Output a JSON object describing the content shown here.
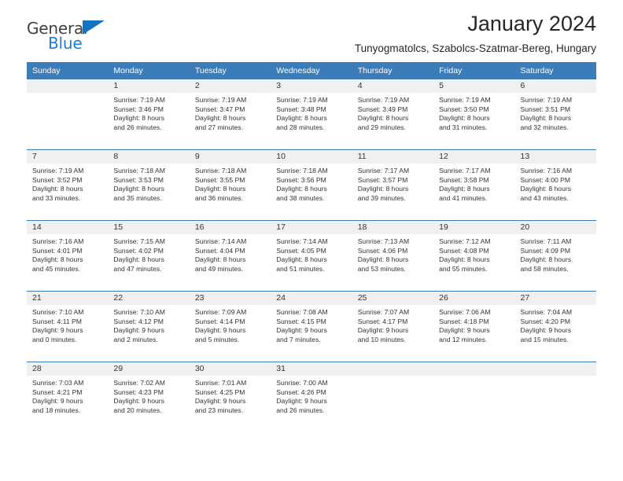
{
  "brand": {
    "name_part1": "General",
    "name_part2": "Blue",
    "accent_color": "#1e7fd0",
    "triangle_color": "#1274bf",
    "triangle_icon": "triangle-icon"
  },
  "header": {
    "title": "January 2024",
    "subtitle": "Tunyogmatolcs, Szabolcs-Szatmar-Bereg, Hungary"
  },
  "calendar": {
    "header_bg": "#3b7cb9",
    "daynum_bg": "#f0f0f0",
    "weekday_headers": [
      "Sunday",
      "Monday",
      "Tuesday",
      "Wednesday",
      "Thursday",
      "Friday",
      "Saturday"
    ],
    "weeks": [
      [
        {
          "day": "",
          "empty": true,
          "sunrise": "",
          "sunset": "",
          "daylight_line1": "",
          "daylight_line2": ""
        },
        {
          "day": "1",
          "sunrise": "Sunrise: 7:19 AM",
          "sunset": "Sunset: 3:46 PM",
          "daylight_line1": "Daylight: 8 hours",
          "daylight_line2": "and 26 minutes."
        },
        {
          "day": "2",
          "sunrise": "Sunrise: 7:19 AM",
          "sunset": "Sunset: 3:47 PM",
          "daylight_line1": "Daylight: 8 hours",
          "daylight_line2": "and 27 minutes."
        },
        {
          "day": "3",
          "sunrise": "Sunrise: 7:19 AM",
          "sunset": "Sunset: 3:48 PM",
          "daylight_line1": "Daylight: 8 hours",
          "daylight_line2": "and 28 minutes."
        },
        {
          "day": "4",
          "sunrise": "Sunrise: 7:19 AM",
          "sunset": "Sunset: 3:49 PM",
          "daylight_line1": "Daylight: 8 hours",
          "daylight_line2": "and 29 minutes."
        },
        {
          "day": "5",
          "sunrise": "Sunrise: 7:19 AM",
          "sunset": "Sunset: 3:50 PM",
          "daylight_line1": "Daylight: 8 hours",
          "daylight_line2": "and 31 minutes."
        },
        {
          "day": "6",
          "sunrise": "Sunrise: 7:19 AM",
          "sunset": "Sunset: 3:51 PM",
          "daylight_line1": "Daylight: 8 hours",
          "daylight_line2": "and 32 minutes."
        }
      ],
      [
        {
          "day": "7",
          "sunrise": "Sunrise: 7:19 AM",
          "sunset": "Sunset: 3:52 PM",
          "daylight_line1": "Daylight: 8 hours",
          "daylight_line2": "and 33 minutes."
        },
        {
          "day": "8",
          "sunrise": "Sunrise: 7:18 AM",
          "sunset": "Sunset: 3:53 PM",
          "daylight_line1": "Daylight: 8 hours",
          "daylight_line2": "and 35 minutes."
        },
        {
          "day": "9",
          "sunrise": "Sunrise: 7:18 AM",
          "sunset": "Sunset: 3:55 PM",
          "daylight_line1": "Daylight: 8 hours",
          "daylight_line2": "and 36 minutes."
        },
        {
          "day": "10",
          "sunrise": "Sunrise: 7:18 AM",
          "sunset": "Sunset: 3:56 PM",
          "daylight_line1": "Daylight: 8 hours",
          "daylight_line2": "and 38 minutes."
        },
        {
          "day": "11",
          "sunrise": "Sunrise: 7:17 AM",
          "sunset": "Sunset: 3:57 PM",
          "daylight_line1": "Daylight: 8 hours",
          "daylight_line2": "and 39 minutes."
        },
        {
          "day": "12",
          "sunrise": "Sunrise: 7:17 AM",
          "sunset": "Sunset: 3:58 PM",
          "daylight_line1": "Daylight: 8 hours",
          "daylight_line2": "and 41 minutes."
        },
        {
          "day": "13",
          "sunrise": "Sunrise: 7:16 AM",
          "sunset": "Sunset: 4:00 PM",
          "daylight_line1": "Daylight: 8 hours",
          "daylight_line2": "and 43 minutes."
        }
      ],
      [
        {
          "day": "14",
          "sunrise": "Sunrise: 7:16 AM",
          "sunset": "Sunset: 4:01 PM",
          "daylight_line1": "Daylight: 8 hours",
          "daylight_line2": "and 45 minutes."
        },
        {
          "day": "15",
          "sunrise": "Sunrise: 7:15 AM",
          "sunset": "Sunset: 4:02 PM",
          "daylight_line1": "Daylight: 8 hours",
          "daylight_line2": "and 47 minutes."
        },
        {
          "day": "16",
          "sunrise": "Sunrise: 7:14 AM",
          "sunset": "Sunset: 4:04 PM",
          "daylight_line1": "Daylight: 8 hours",
          "daylight_line2": "and 49 minutes."
        },
        {
          "day": "17",
          "sunrise": "Sunrise: 7:14 AM",
          "sunset": "Sunset: 4:05 PM",
          "daylight_line1": "Daylight: 8 hours",
          "daylight_line2": "and 51 minutes."
        },
        {
          "day": "18",
          "sunrise": "Sunrise: 7:13 AM",
          "sunset": "Sunset: 4:06 PM",
          "daylight_line1": "Daylight: 8 hours",
          "daylight_line2": "and 53 minutes."
        },
        {
          "day": "19",
          "sunrise": "Sunrise: 7:12 AM",
          "sunset": "Sunset: 4:08 PM",
          "daylight_line1": "Daylight: 8 hours",
          "daylight_line2": "and 55 minutes."
        },
        {
          "day": "20",
          "sunrise": "Sunrise: 7:11 AM",
          "sunset": "Sunset: 4:09 PM",
          "daylight_line1": "Daylight: 8 hours",
          "daylight_line2": "and 58 minutes."
        }
      ],
      [
        {
          "day": "21",
          "sunrise": "Sunrise: 7:10 AM",
          "sunset": "Sunset: 4:11 PM",
          "daylight_line1": "Daylight: 9 hours",
          "daylight_line2": "and 0 minutes."
        },
        {
          "day": "22",
          "sunrise": "Sunrise: 7:10 AM",
          "sunset": "Sunset: 4:12 PM",
          "daylight_line1": "Daylight: 9 hours",
          "daylight_line2": "and 2 minutes."
        },
        {
          "day": "23",
          "sunrise": "Sunrise: 7:09 AM",
          "sunset": "Sunset: 4:14 PM",
          "daylight_line1": "Daylight: 9 hours",
          "daylight_line2": "and 5 minutes."
        },
        {
          "day": "24",
          "sunrise": "Sunrise: 7:08 AM",
          "sunset": "Sunset: 4:15 PM",
          "daylight_line1": "Daylight: 9 hours",
          "daylight_line2": "and 7 minutes."
        },
        {
          "day": "25",
          "sunrise": "Sunrise: 7:07 AM",
          "sunset": "Sunset: 4:17 PM",
          "daylight_line1": "Daylight: 9 hours",
          "daylight_line2": "and 10 minutes."
        },
        {
          "day": "26",
          "sunrise": "Sunrise: 7:06 AM",
          "sunset": "Sunset: 4:18 PM",
          "daylight_line1": "Daylight: 9 hours",
          "daylight_line2": "and 12 minutes."
        },
        {
          "day": "27",
          "sunrise": "Sunrise: 7:04 AM",
          "sunset": "Sunset: 4:20 PM",
          "daylight_line1": "Daylight: 9 hours",
          "daylight_line2": "and 15 minutes."
        }
      ],
      [
        {
          "day": "28",
          "sunrise": "Sunrise: 7:03 AM",
          "sunset": "Sunset: 4:21 PM",
          "daylight_line1": "Daylight: 9 hours",
          "daylight_line2": "and 18 minutes."
        },
        {
          "day": "29",
          "sunrise": "Sunrise: 7:02 AM",
          "sunset": "Sunset: 4:23 PM",
          "daylight_line1": "Daylight: 9 hours",
          "daylight_line2": "and 20 minutes."
        },
        {
          "day": "30",
          "sunrise": "Sunrise: 7:01 AM",
          "sunset": "Sunset: 4:25 PM",
          "daylight_line1": "Daylight: 9 hours",
          "daylight_line2": "and 23 minutes."
        },
        {
          "day": "31",
          "sunrise": "Sunrise: 7:00 AM",
          "sunset": "Sunset: 4:26 PM",
          "daylight_line1": "Daylight: 9 hours",
          "daylight_line2": "and 26 minutes."
        },
        {
          "day": "",
          "empty": true,
          "sunrise": "",
          "sunset": "",
          "daylight_line1": "",
          "daylight_line2": ""
        },
        {
          "day": "",
          "empty": true,
          "sunrise": "",
          "sunset": "",
          "daylight_line1": "",
          "daylight_line2": ""
        },
        {
          "day": "",
          "empty": true,
          "sunrise": "",
          "sunset": "",
          "daylight_line1": "",
          "daylight_line2": ""
        }
      ]
    ]
  }
}
